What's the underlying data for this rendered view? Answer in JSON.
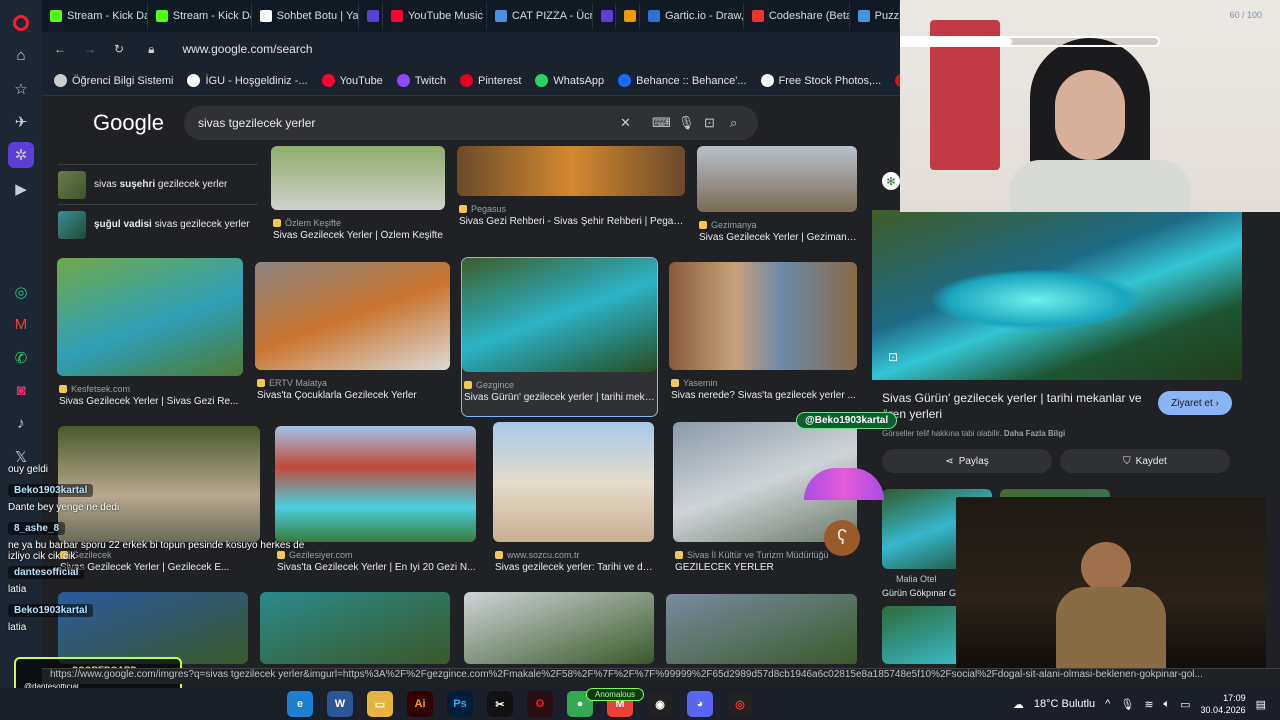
{
  "tabs": [
    {
      "label": "Stream - Kick Dash",
      "color": "#53fc18"
    },
    {
      "label": "Stream - Kick Dash",
      "color": "#53fc18"
    },
    {
      "label": "Sohbet Botu | Yayı",
      "color": "#ffffff"
    },
    {
      "label": "",
      "color": "#5b3fd6"
    },
    {
      "label": "YouTube Music",
      "color": "#ff0033"
    },
    {
      "label": "CAT PIZZA - Ücrets",
      "color": "#4a90e2"
    },
    {
      "label": "",
      "color": "#5b3fd6"
    },
    {
      "label": "",
      "color": "#f29900"
    },
    {
      "label": "Gartic.io - Draw, G",
      "color": "#2f6fd6"
    },
    {
      "label": "Codeshare (Beta)",
      "color": "#e33"
    },
    {
      "label": "Puzz",
      "color": "#4a90e2"
    }
  ],
  "address": {
    "url": "www.google.com/search"
  },
  "bookmarks": [
    {
      "label": "Öğrenci Bilgi Sistemi",
      "color": "#ccc"
    },
    {
      "label": "İGU - Hoşgeldiniz -...",
      "color": "#fff"
    },
    {
      "label": "YouTube",
      "color": "#ff0033"
    },
    {
      "label": "Twitch",
      "color": "#9146ff"
    },
    {
      "label": "Pinterest",
      "color": "#e60023"
    },
    {
      "label": "WhatsApp",
      "color": "#25d366"
    },
    {
      "label": "Behance :: Behance'...",
      "color": "#1769ff"
    },
    {
      "label": "Free Stock Photos,...",
      "color": "#fff"
    },
    {
      "label": "DaFont - Down",
      "color": "#d11"
    }
  ],
  "google": {
    "logo": "Google",
    "query": "sivas tgezilecek yerler"
  },
  "suggestions": [
    {
      "pre": "sivas ",
      "bold": "suşehri",
      "post": " gezilecek yerler"
    },
    {
      "pre": "",
      "bold": "şuğul vadisi",
      "post": " sivas gezilecek yerler"
    }
  ],
  "results": [
    {
      "source": "Özlem Keşifte",
      "title": "Sivas Gezilecek Yerler | Özlem Keşifte"
    },
    {
      "source": "Pegasus",
      "title": "Sivas Gezi Rehberi - Sivas Şehir Rehberi | Pegasus"
    },
    {
      "source": "Gezimanya",
      "title": "Sivas Gezilecek Yerler | Gezimanya"
    },
    {
      "source": "Kesfetsek.com",
      "title": "Sivas Gezilecek Yerler | Sivas Gezi Re..."
    },
    {
      "source": "ERTV Malatya",
      "title": "Sivas'ta Çocuklarla Gezilecek Yerler"
    },
    {
      "source": "Gezgince",
      "title": "Sivas Gürün' gezilecek yerler | tarihi meka..."
    },
    {
      "source": "Yasemin",
      "title": "Sivas nerede? Sivas'ta gezilecek yerler ..."
    },
    {
      "source": "Gezilecek",
      "title": "Sivas Gezilecek Yerler | Gezilecek E..."
    },
    {
      "source": "Gezilesiyer.com",
      "title": "Sivas'ta Gezilecek Yerler | En İyi 20 Gezi N..."
    },
    {
      "source": "www.sozcu.com.tr",
      "title": "Sivas gezilecek yerler: Tarihi ve do..."
    },
    {
      "source": "Sivas İl Kültür ve Turizm Müdürlüğü",
      "title": "GEZİLECEK YERLER"
    }
  ],
  "panel": {
    "title": "Sivas Gürün' gezilecek yerler | tarihi mekanlar ve ören yerleri",
    "visit": "Ziyaret et",
    "license_text": "Görseller telif hakkına tabi olabilir.",
    "license_link": "Daha Fazla Bilgi",
    "share": "Paylaş",
    "save": "Kaydet",
    "related_source": "Malia Otel",
    "related_title": "Gürün Gökpınar Gö"
  },
  "overlay": {
    "progress": "60 / 100",
    "mention": "@Beko1903kartal",
    "scoreboard": "SCOREBOARD",
    "score_user": "@dantesofficial"
  },
  "chat": [
    {
      "user": "",
      "text": "ouy geldi"
    },
    {
      "user": "Beko1903kartal",
      "text": "Dante bey yenge ne dedi"
    },
    {
      "user": "8_ashe_8",
      "text": "ne ya bu barbar sporu 22 erkek bi topun pesinde kosuyo herkes de izliyo cik cik cik"
    },
    {
      "user": "dantesofficial",
      "text": "latia"
    },
    {
      "user": "Beko1903kartal",
      "text": "latia"
    }
  ],
  "status_url": "https://www.google.com/imgres?q=sivas tgezilecek yerler&imgurl=https%3A%2F%2Fgezgince.com%2Fmakale%2F58%2F%7F%2F%7F%99999%2F65d2989d57d8cb1946a6c02815e8a185748e5f10%2Fsocial%2Fdogal-sit-alani-olmasi-beklenen-gokpinar-gol...",
  "taskbar": {
    "weather": "18°C Bulutlu",
    "time": "17:09",
    "date": "30.04.2026",
    "anomalous": "Anomalous"
  }
}
